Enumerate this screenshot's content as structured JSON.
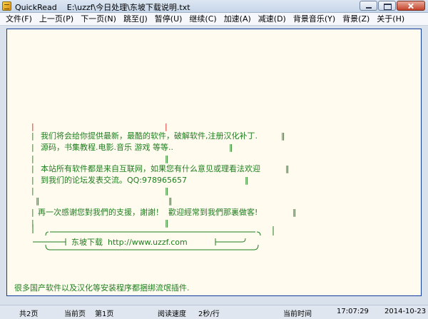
{
  "window": {
    "app_name": "QuickRead",
    "file_path": "E:\\uzzf\\今日处理\\东坡下载说明.txt"
  },
  "menu": [
    "文件(F)",
    "上一页(P)",
    "下一页(N)",
    "跳至(J)",
    "暂停(U)",
    "继续(C)",
    "加速(A)",
    "减速(D)",
    "背景音乐(Y)",
    "背景(Z)",
    "关于(H)"
  ],
  "content": {
    "line1": "我们将会给你提供最新，最酷的软件，破解软件,注册汉化补丁.",
    "line2": "源码，书集教程.电影.音乐 游戏 等等..",
    "line3": "本站所有软件都是来自互联网，如果您有什么意见或理看法欢迎",
    "line4": "到我们的论坛发表交流。QQ:978965657",
    "line5": "再一次感谢您對我們的支援，謝謝！  歡迎經常到我們那裏做客!",
    "banner": "东坡下载  http://www.uzzf.com",
    "footer": "很多国产软件以及汉化等安装程序都捆绑流氓插件."
  },
  "status": {
    "total_pages": "共2页",
    "current_page_label": "当前页",
    "current_page": "第1页",
    "speed_label": "阅读速度",
    "speed": "2秒/行",
    "time_label": "当前时间",
    "time": "17:07:29",
    "date": "2014-10-23"
  }
}
